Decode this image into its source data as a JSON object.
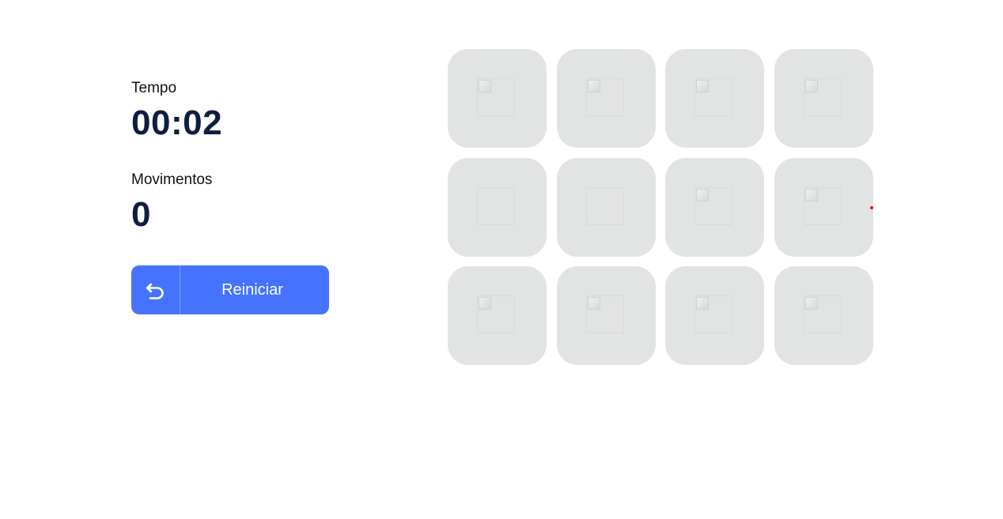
{
  "stats": {
    "time_label": "Tempo",
    "time_value": "00:02",
    "moves_label": "Movimentos",
    "moves_value": "0"
  },
  "controls": {
    "restart_label": "Reiniciar",
    "restart_icon": "undo-arrow-icon",
    "accent_color": "#4573ff"
  },
  "board": {
    "columns": 4,
    "rows": 3,
    "card_color": "#e2e3e3",
    "cards": [
      {
        "state": "face-down",
        "image": "broken-image"
      },
      {
        "state": "face-down",
        "image": "broken-image"
      },
      {
        "state": "face-down",
        "image": "broken-image"
      },
      {
        "state": "face-down",
        "image": "broken-image"
      },
      {
        "state": "face-down",
        "image": "blank"
      },
      {
        "state": "face-down",
        "image": "blank"
      },
      {
        "state": "face-down",
        "image": "broken-image"
      },
      {
        "state": "face-down",
        "image": "broken-image"
      },
      {
        "state": "face-down",
        "image": "broken-image"
      },
      {
        "state": "face-down",
        "image": "broken-image"
      },
      {
        "state": "face-down",
        "image": "broken-image"
      },
      {
        "state": "face-down",
        "image": "broken-image"
      }
    ]
  }
}
